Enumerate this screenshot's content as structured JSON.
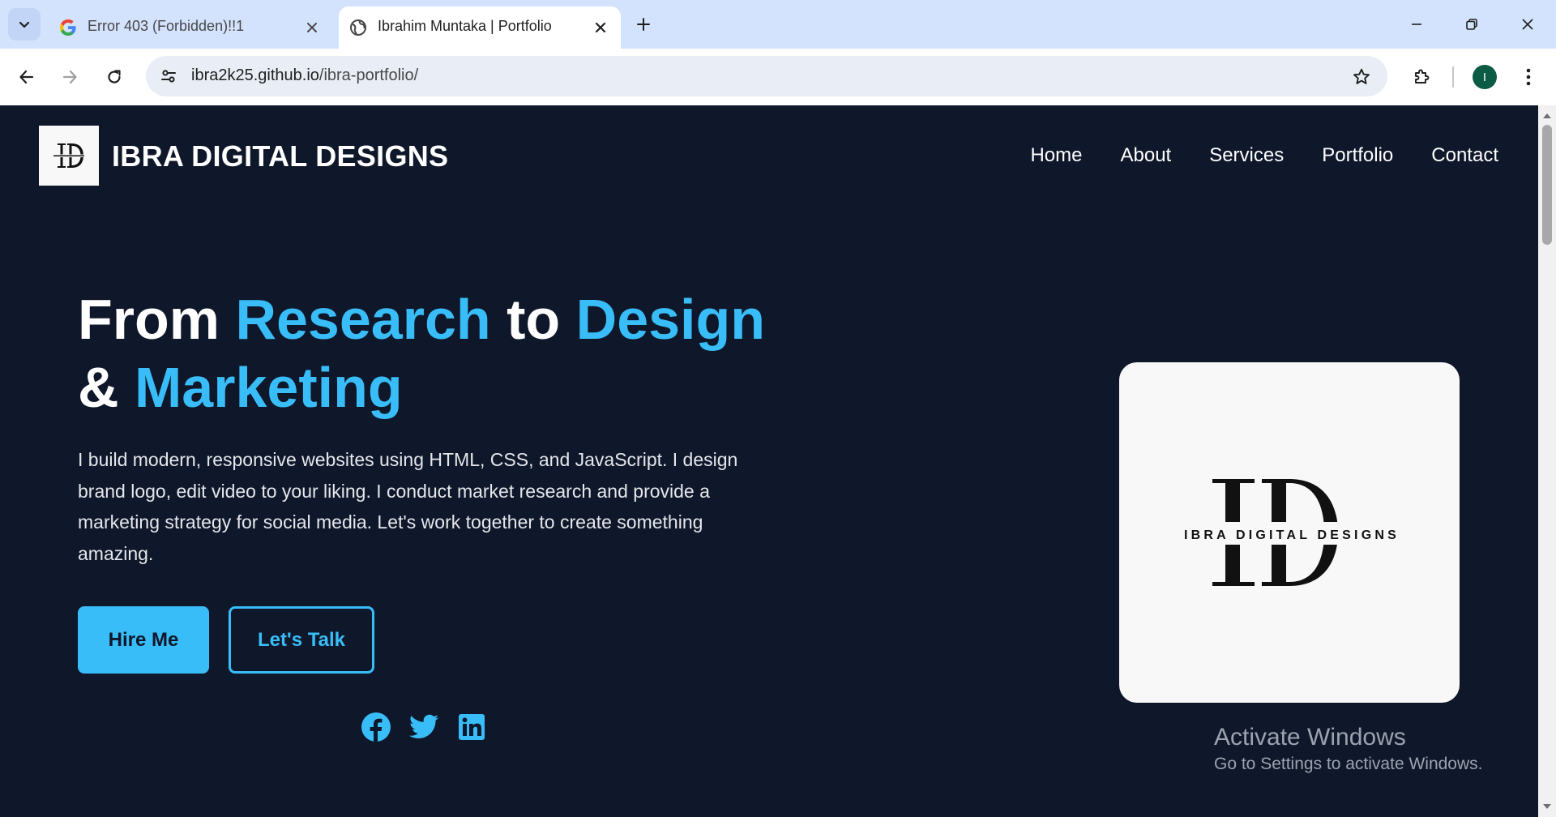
{
  "browser": {
    "tabs": [
      {
        "title": "Error 403 (Forbidden)!!1",
        "active": false,
        "favicon": "google-g-icon"
      },
      {
        "title": "Ibrahim Muntaka | Portfolio",
        "active": true,
        "favicon": "globe-icon"
      }
    ],
    "url_domain": "ibra2k25.github.io",
    "url_path": "/ibra-portfolio/",
    "profile_initial": "I"
  },
  "site": {
    "brand": "IBRA DIGITAL DESIGNS",
    "logo_text": "IBRA DIGITAL DESIGNS",
    "nav": [
      "Home",
      "About",
      "Services",
      "Portfolio",
      "Contact"
    ],
    "hero": {
      "title_parts": [
        "From ",
        "Research",
        " to ",
        "Design",
        " & ",
        "Marketing"
      ],
      "description": "I build modern, responsive websites using HTML, CSS, and JavaScript. I design brand logo, edit video to your liking. I conduct market research and provide a marketing strategy for social media. Let's work together to create something amazing.",
      "primary_button": "Hire Me",
      "secondary_button": "Let's Talk"
    },
    "social_icons": [
      "facebook-icon",
      "twitter-icon",
      "linkedin-icon"
    ]
  },
  "os_overlay": {
    "activate_title": "Activate Windows",
    "activate_subtitle": "Go to Settings to activate Windows."
  },
  "colors": {
    "page_bg": "#0f172a",
    "accent": "#38bdf8",
    "tab_strip": "#d3e3fd"
  }
}
